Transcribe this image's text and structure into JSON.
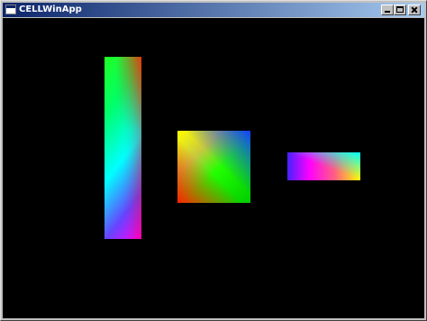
{
  "window": {
    "title": "CELLWinApp",
    "icon": "app-window-icon",
    "controls": [
      "minimize-icon",
      "maximize-icon",
      "close-icon"
    ]
  },
  "canvas": {
    "background": "#000000",
    "shapes": [
      {
        "name": "tall-gradient-quad",
        "colors": [
          "#22ff22",
          "#ff2000",
          "#00ffff",
          "#ff00ff"
        ]
      },
      {
        "name": "square-gradient-quad",
        "colors": [
          "#ffff00",
          "#1040ff",
          "#ff2000",
          "#22ff00"
        ]
      },
      {
        "name": "small-gradient-quad",
        "colors": [
          "#4422ff",
          "#ff00ff",
          "#00ffff",
          "#ffff00"
        ]
      }
    ]
  }
}
